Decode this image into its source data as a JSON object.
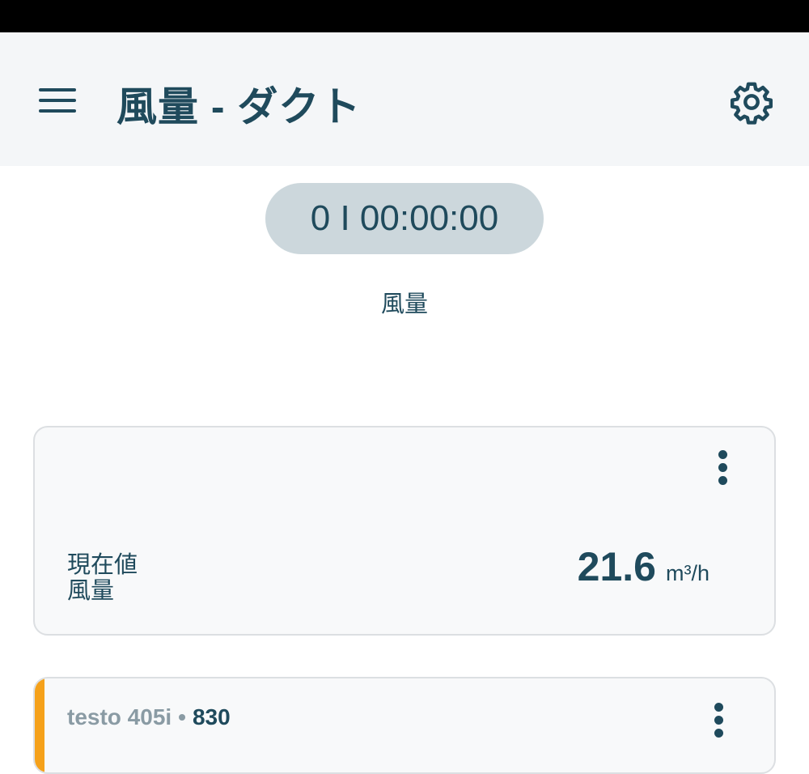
{
  "header": {
    "title": "風量 - ダクト",
    "menu_icon": "menu-icon",
    "settings_icon": "gear-icon"
  },
  "timer": {
    "text": "0 I 00:00:00"
  },
  "measurement_label": "風量",
  "reading_card": {
    "label_line1": "現在値",
    "label_line2": "風量",
    "value": "21.6",
    "unit": "m³/h",
    "menu_icon": "more-vertical-icon"
  },
  "probe_card": {
    "name": "testo 405i",
    "separator": "•",
    "serial": "830",
    "accent_color": "#f5a11a",
    "menu_icon": "more-vertical-icon"
  },
  "colors": {
    "primary_text": "#1f4a5c",
    "app_bar_bg": "#f4f6f8",
    "timer_bg": "#ccd7dc",
    "card_bg": "#f8f9fa",
    "muted_text": "#8a9ba4"
  }
}
